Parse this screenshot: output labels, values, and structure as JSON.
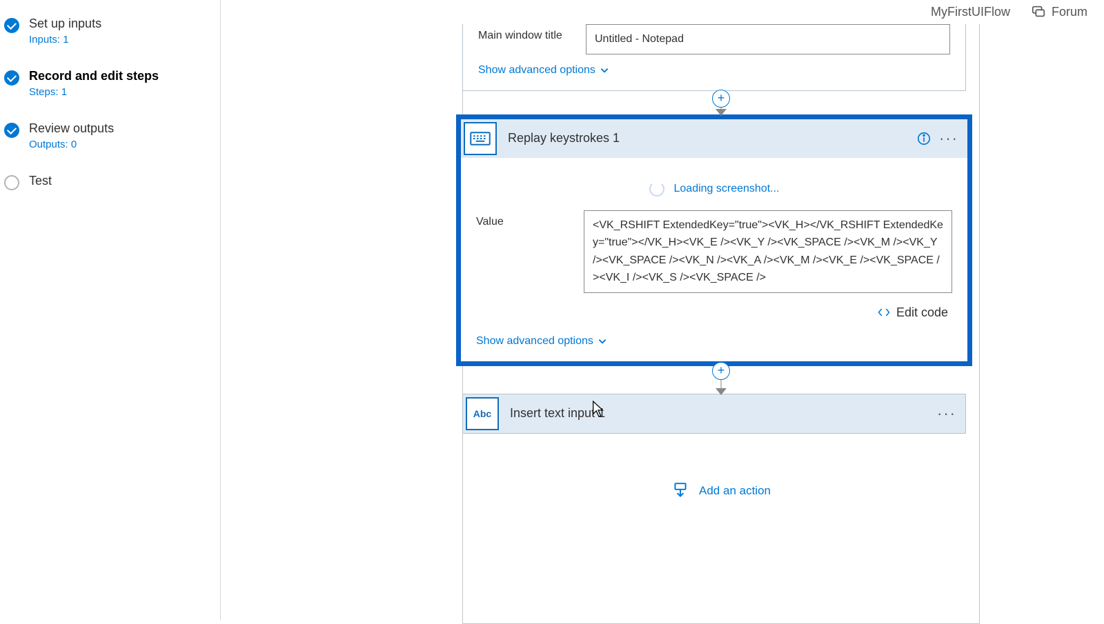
{
  "header": {
    "flow_name": "MyFirstUIFlow",
    "forum_label": "Forum"
  },
  "sidebar": {
    "steps": [
      {
        "title": "Set up inputs",
        "sub": "Inputs: 1",
        "done": true,
        "active": false
      },
      {
        "title": "Record and edit steps",
        "sub": "Steps: 1",
        "done": true,
        "active": true
      },
      {
        "title": "Review outputs",
        "sub": "Outputs: 0",
        "done": true,
        "active": false
      },
      {
        "title": "Test",
        "sub": "",
        "done": false,
        "active": false
      }
    ]
  },
  "top_card": {
    "field_label": "Main window title",
    "field_value": "Untitled - Notepad",
    "advanced": "Show advanced options"
  },
  "replay_card": {
    "title": "Replay keystrokes 1",
    "loading_text": "Loading screenshot...",
    "value_label": "Value",
    "value_text": "<VK_RSHIFT ExtendedKey=\"true\"><VK_H></VK_RSHIFT ExtendedKey=\"true\"></VK_H><VK_E /><VK_Y /><VK_SPACE /><VK_M /><VK_Y /><VK_SPACE /><VK_N /><VK_A /><VK_M /><VK_E /><VK_SPACE /><VK_I /><VK_S /><VK_SPACE />",
    "edit_code": "Edit code",
    "advanced": "Show advanced options",
    "icon_label": "keyboard-icon"
  },
  "insert_card": {
    "title": "Insert text input 1",
    "icon_text": "Abc"
  },
  "add_action": "Add an action"
}
